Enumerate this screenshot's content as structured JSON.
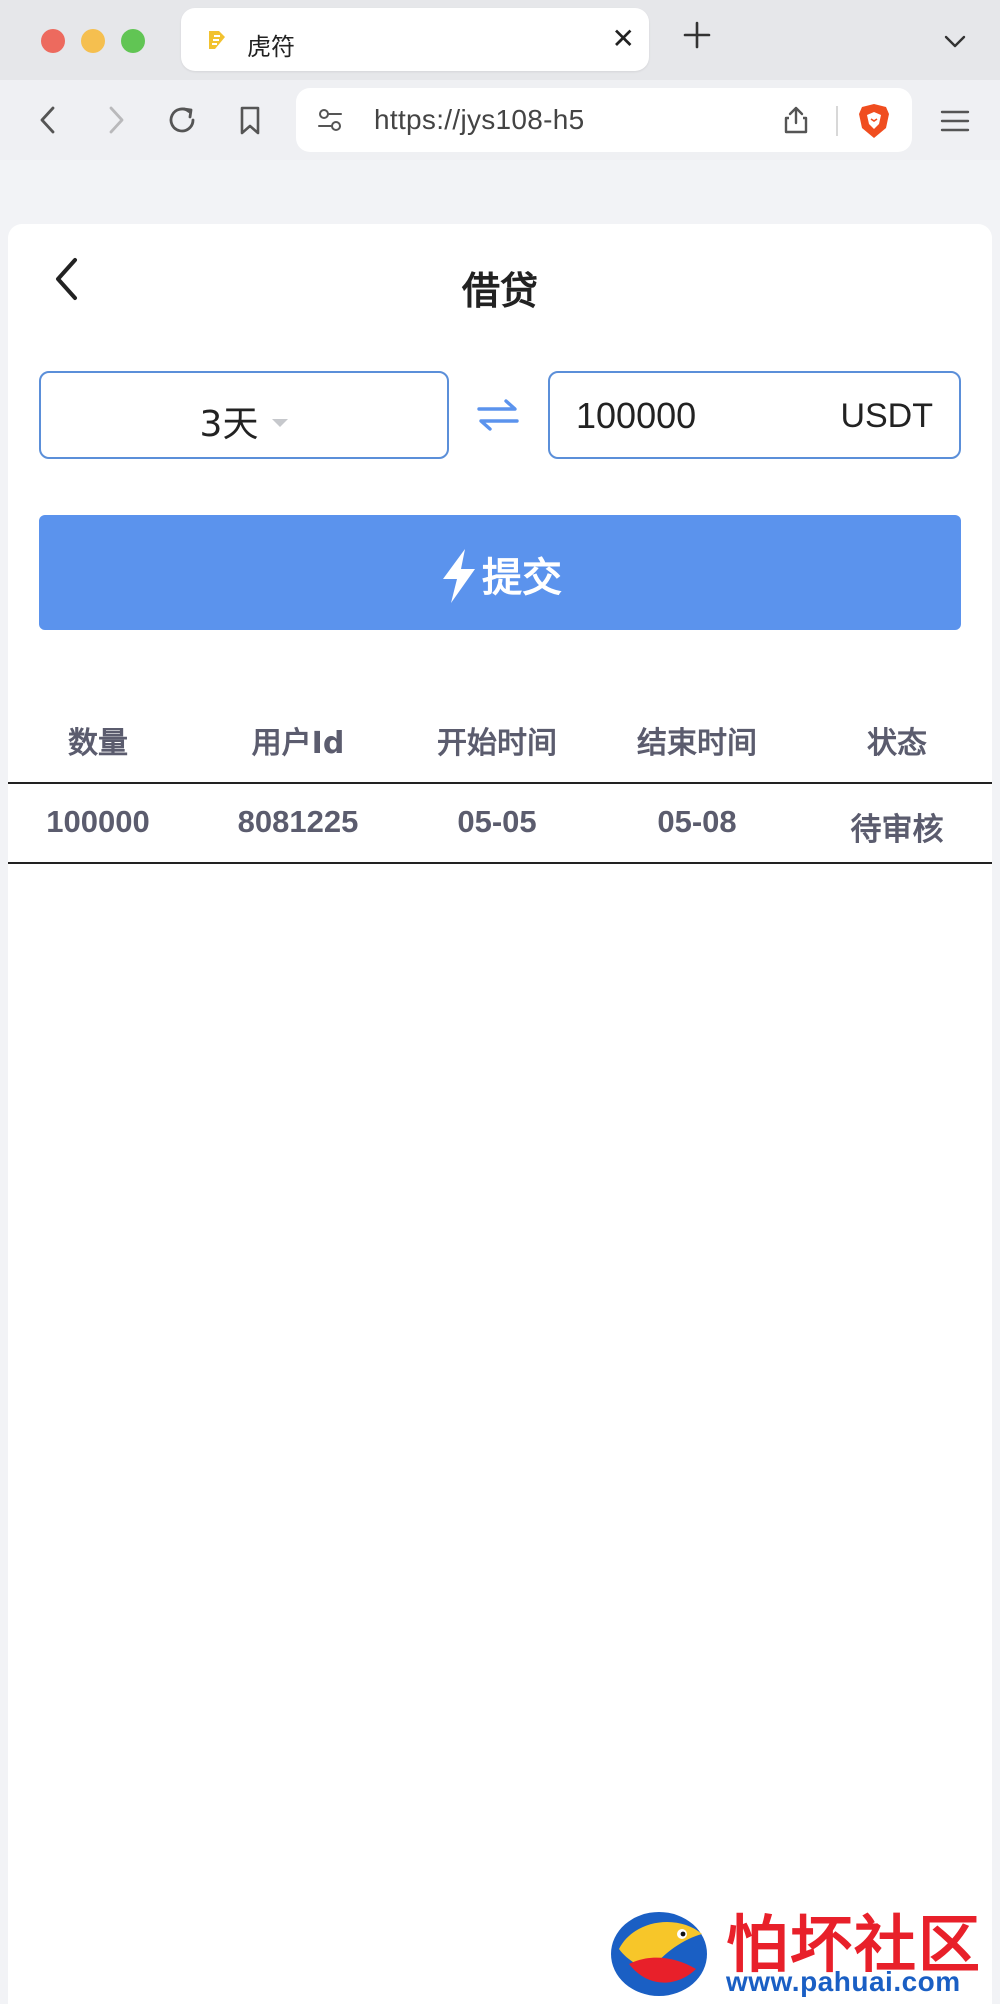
{
  "browser": {
    "tab_title": "虎符",
    "url": "https://jys108-h5"
  },
  "page": {
    "title": "借贷",
    "period": {
      "selected": "3天"
    },
    "amount": {
      "value": "100000",
      "unit": "USDT"
    },
    "submit_label": "提交",
    "table": {
      "headers": [
        "数量",
        "用户Id",
        "开始时间",
        "结束时间",
        "状态"
      ],
      "rows": [
        [
          "100000",
          "8081225",
          "05-05",
          "05-08",
          "待审核"
        ]
      ]
    }
  },
  "watermark": {
    "text": "怕坏社区",
    "url": "www.pahuai.com"
  },
  "colors": {
    "accent": "#5b93ed",
    "border": "#5b8fd9",
    "text_muted": "#5b5c6e",
    "watermark_red": "#e8202a",
    "watermark_blue": "#1a5fc4"
  }
}
